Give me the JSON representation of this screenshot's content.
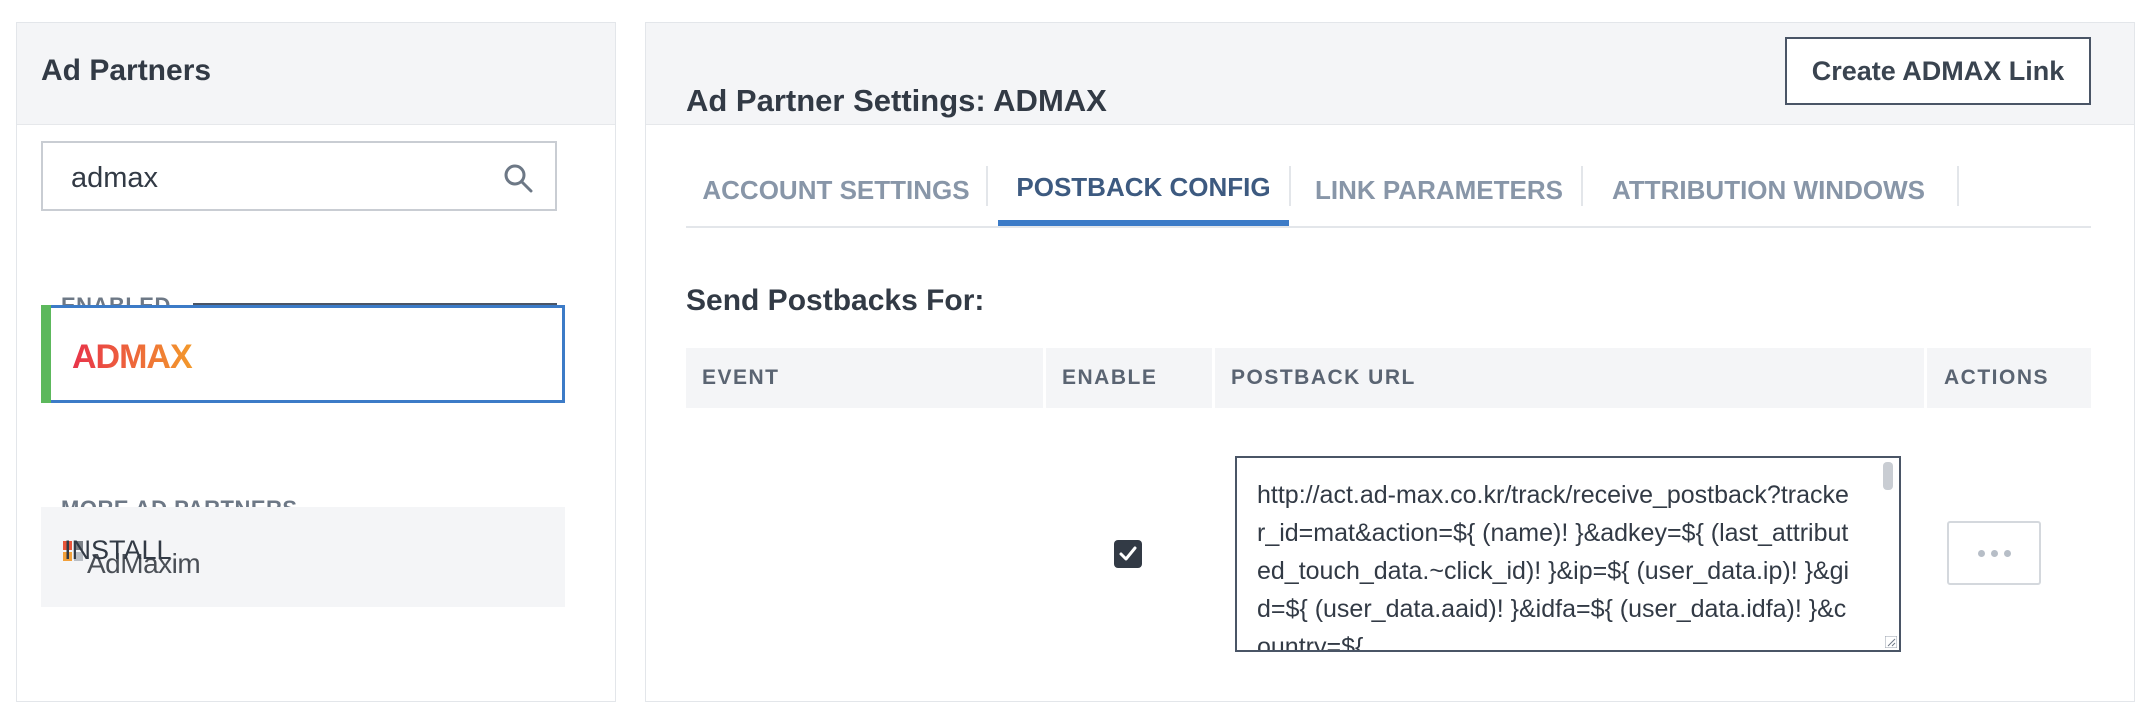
{
  "left_panel": {
    "title": "Ad Partners",
    "search": {
      "value": "admax",
      "placeholder": ""
    },
    "enabled_label": "ENABLED",
    "enabled_partner": {
      "logo_text": "ADMAX"
    },
    "more_label": "MORE AD PARTNERS",
    "more_partner": {
      "logo_text": "AdMaxim"
    }
  },
  "right_panel": {
    "title": "Ad Partner Settings: ADMAX",
    "create_button": "Create ADMAX Link",
    "tabs": [
      {
        "label": "ACCOUNT SETTINGS",
        "active": false
      },
      {
        "label": "POSTBACK CONFIG",
        "active": true
      },
      {
        "label": "LINK PARAMETERS",
        "active": false
      },
      {
        "label": "ATTRIBUTION WINDOWS",
        "active": false
      }
    ],
    "section_title": "Send Postbacks For:",
    "table": {
      "headers": [
        "EVENT",
        "ENABLE",
        "POSTBACK URL",
        "ACTIONS"
      ],
      "rows": [
        {
          "event": "INSTALL",
          "enabled": true,
          "postback_url": "http://act.ad-max.co.kr/track/receive_postback?tracker_id=mat&action=${ (name)! }&adkey=${ (last_attributed_touch_data.~click_id)! }&ip=${ (user_data.ip)! }&gid=${ (user_data.aaid)! }&idfa=${ (user_data.idfa)! }&country=${"
        }
      ]
    }
  },
  "colors": {
    "accent": "#3c7bc7",
    "enabled_bar": "#5cb85c",
    "admax_gradient_start": "#e8334a",
    "admax_gradient_end": "#f39a2b"
  },
  "icons": [
    "search-icon",
    "checkmark-icon",
    "more-dots-icon",
    "resize-handle-icon"
  ]
}
